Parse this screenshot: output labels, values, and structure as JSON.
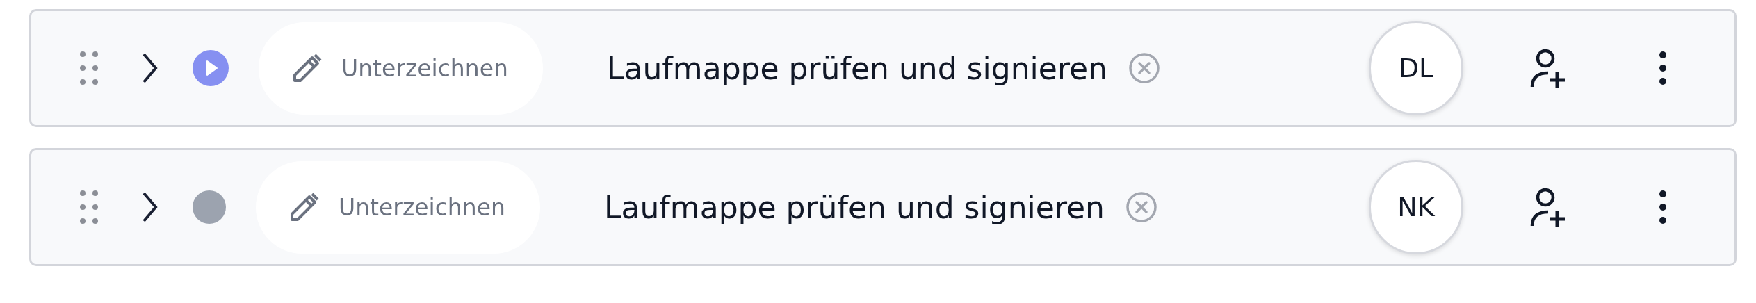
{
  "rows": [
    {
      "expanded": false,
      "kind": "running",
      "action": "Unterzeichnen",
      "title": "Laufmappe prüfen und signieren",
      "assignee": "DL"
    },
    {
      "expanded": false,
      "kind": "idle",
      "action": "Unterzeichnen",
      "title": "Laufmappe prüfen und signieren",
      "assignee": "NK"
    }
  ]
}
